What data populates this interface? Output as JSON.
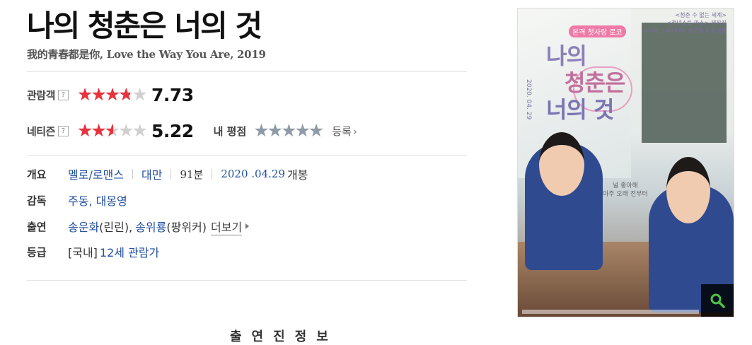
{
  "movie": {
    "title": "나의 청춘은 너의 것",
    "subtitle": "我的青春都是你, Love the Way You Are, 2019"
  },
  "ratings": {
    "audience": {
      "label": "관람객",
      "help": "?",
      "score": "7.73",
      "fraction": 0.773
    },
    "netizen": {
      "label": "네티즌",
      "help": "?",
      "score": "5.22",
      "fraction": 0.522
    },
    "my_rating": {
      "label": "내 평점",
      "register_label": "등록",
      "arrow": "›"
    }
  },
  "info": {
    "overview": {
      "label": "개요",
      "genre": "멜로/로맨스",
      "country": "대만",
      "runtime": "91분",
      "release_date": "2020 .04.29",
      "release_suffix": "개봉"
    },
    "director": {
      "label": "감독",
      "names": "주동, 대몽영"
    },
    "cast": {
      "label": "출연",
      "actor1": "송운화",
      "role1": "(린린),",
      "actor2": "송위룡",
      "role2": "(팡위커)",
      "more": "더보기"
    },
    "grade": {
      "label": "등급",
      "prefix": "[국내]",
      "value": "12세 관람가"
    }
  },
  "poster": {
    "title_lines": [
      "나의",
      "청춘은",
      "너의 것"
    ],
    "tag": "본격 첫사랑 로코",
    "date": "2020. 04. 29",
    "credits_top": [
      "<청춘 수 없는 세계>",
      "<청년스토 마스> 제작진",
      "<나의 소녀시대> 송운화 X 송위룡"
    ],
    "tagline": [
      "널 좋아해",
      "아주 오래 전부터"
    ],
    "zoom_icon": "search-icon"
  },
  "bottom_partial_text": "출연진정보"
}
